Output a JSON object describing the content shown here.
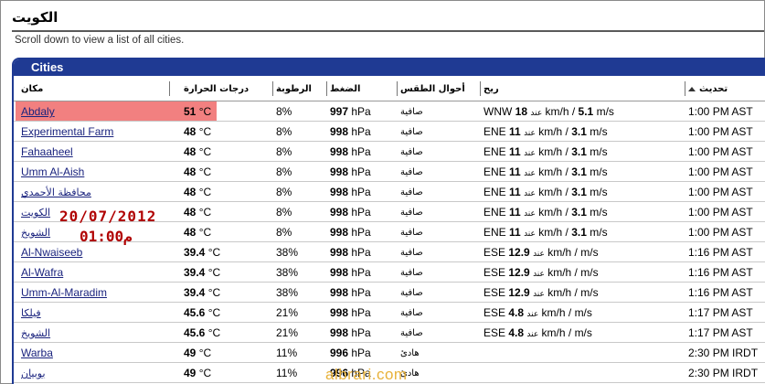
{
  "page": {
    "title": "الكويت",
    "subtitle": "Scroll down to view a list of all cities."
  },
  "panel": {
    "heading": "Cities"
  },
  "columns": {
    "place": "مكان",
    "temperature": "درجات الحرارة",
    "humidity": "الرطوبة",
    "pressure": "الضغط",
    "conditions": "أحوال الطقس",
    "wind": "ريح",
    "updated": "تحديث"
  },
  "rows": [
    {
      "name": "Abdaly",
      "temp": "51",
      "temp_unit": "°C",
      "hum": "8%",
      "pres": "997",
      "pres_unit": "hPa",
      "cond": "صافية",
      "dir": "WNW",
      "spd1": "18",
      "at": "عند",
      "unit1": "km/h /",
      "spd2": "5.1",
      "unit2": "m/s",
      "time": "1:00 PM AST"
    },
    {
      "name": "Experimental Farm",
      "temp": "48",
      "temp_unit": "°C",
      "hum": "8%",
      "pres": "998",
      "pres_unit": "hPa",
      "cond": "صافية",
      "dir": "ENE",
      "spd1": "11",
      "at": "عند",
      "unit1": "km/h /",
      "spd2": "3.1",
      "unit2": "m/s",
      "time": "1:00 PM AST"
    },
    {
      "name": "Fahaaheel",
      "temp": "48",
      "temp_unit": "°C",
      "hum": "8%",
      "pres": "998",
      "pres_unit": "hPa",
      "cond": "صافية",
      "dir": "ENE",
      "spd1": "11",
      "at": "عند",
      "unit1": "km/h /",
      "spd2": "3.1",
      "unit2": "m/s",
      "time": "1:00 PM AST"
    },
    {
      "name": "Umm Al-Aish",
      "temp": "48",
      "temp_unit": "°C",
      "hum": "8%",
      "pres": "998",
      "pres_unit": "hPa",
      "cond": "صافية",
      "dir": "ENE",
      "spd1": "11",
      "at": "عند",
      "unit1": "km/h /",
      "spd2": "3.1",
      "unit2": "m/s",
      "time": "1:00 PM AST"
    },
    {
      "name": "محافظة الأحمدي",
      "temp": "48",
      "temp_unit": "°C",
      "hum": "8%",
      "pres": "998",
      "pres_unit": "hPa",
      "cond": "صافية",
      "dir": "ENE",
      "spd1": "11",
      "at": "عند",
      "unit1": "km/h /",
      "spd2": "3.1",
      "unit2": "m/s",
      "time": "1:00 PM AST"
    },
    {
      "name": "الكويت",
      "temp": "48",
      "temp_unit": "°C",
      "hum": "8%",
      "pres": "998",
      "pres_unit": "hPa",
      "cond": "صافية",
      "dir": "ENE",
      "spd1": "11",
      "at": "عند",
      "unit1": "km/h /",
      "spd2": "3.1",
      "unit2": "m/s",
      "time": "1:00 PM AST"
    },
    {
      "name": "الشويخ",
      "temp": "48",
      "temp_unit": "°C",
      "hum": "8%",
      "pres": "998",
      "pres_unit": "hPa",
      "cond": "صافية",
      "dir": "ENE",
      "spd1": "11",
      "at": "عند",
      "unit1": "km/h /",
      "spd2": "3.1",
      "unit2": "m/s",
      "time": "1:00 PM AST"
    },
    {
      "name": "Al-Nwaiseeb",
      "temp": "39.4",
      "temp_unit": "°C",
      "hum": "38%",
      "pres": "998",
      "pres_unit": "hPa",
      "cond": "صافية",
      "dir": "ESE",
      "spd1": "12.9",
      "at": "عند",
      "unit1": "km/h /",
      "spd2": "",
      "unit2": "m/s",
      "time": "1:16 PM AST"
    },
    {
      "name": "Al-Wafra",
      "temp": "39.4",
      "temp_unit": "°C",
      "hum": "38%",
      "pres": "998",
      "pres_unit": "hPa",
      "cond": "صافية",
      "dir": "ESE",
      "spd1": "12.9",
      "at": "عند",
      "unit1": "km/h /",
      "spd2": "",
      "unit2": "m/s",
      "time": "1:16 PM AST"
    },
    {
      "name": "Umm-Al-Maradim",
      "temp": "39.4",
      "temp_unit": "°C",
      "hum": "38%",
      "pres": "998",
      "pres_unit": "hPa",
      "cond": "صافية",
      "dir": "ESE",
      "spd1": "12.9",
      "at": "عند",
      "unit1": "km/h /",
      "spd2": "",
      "unit2": "m/s",
      "time": "1:16 PM AST"
    },
    {
      "name": "فيلكا",
      "temp": "45.6",
      "temp_unit": "°C",
      "hum": "21%",
      "pres": "998",
      "pres_unit": "hPa",
      "cond": "صافية",
      "dir": "ESE",
      "spd1": "4.8",
      "at": "عند",
      "unit1": "km/h /",
      "spd2": "",
      "unit2": "m/s",
      "time": "1:17 PM AST"
    },
    {
      "name": "الشويخ",
      "temp": "45.6",
      "temp_unit": "°C",
      "hum": "21%",
      "pres": "998",
      "pres_unit": "hPa",
      "cond": "صافية",
      "dir": "ESE",
      "spd1": "4.8",
      "at": "عند",
      "unit1": "km/h /",
      "spd2": "",
      "unit2": "m/s",
      "time": "1:17 PM AST"
    },
    {
      "name": "Warba",
      "temp": "49",
      "temp_unit": "°C",
      "hum": "11%",
      "pres": "996",
      "pres_unit": "hPa",
      "cond": "هادئ",
      "dir": "",
      "spd1": "",
      "at": "",
      "unit1": "",
      "spd2": "",
      "unit2": "",
      "time": "2:30 PM IRDT"
    },
    {
      "name": "بوبيان",
      "temp": "49",
      "temp_unit": "°C",
      "hum": "11%",
      "pres": "996",
      "pres_unit": "hPa",
      "cond": "هادئ",
      "dir": "",
      "spd1": "",
      "at": "",
      "unit1": "",
      "spd2": "",
      "unit2": "",
      "time": "2:30 PM IRDT"
    }
  ],
  "overlay": {
    "date": "20/07/2012",
    "time": "01:00م"
  },
  "watermark": "albrari.com",
  "colors": {
    "panel_header": "#1f3a93",
    "highlight_row": "#f28080",
    "overlay_text": "#b00000",
    "link": "#1a237e",
    "watermark": "#e8b23a"
  }
}
